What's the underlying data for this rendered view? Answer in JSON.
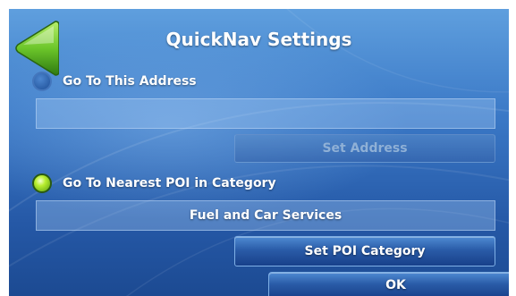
{
  "header": {
    "title": "QuickNav Settings",
    "back_icon": "back-arrow-icon"
  },
  "options": {
    "address": {
      "label": "Go To This Address",
      "selected": false
    },
    "poi": {
      "label": "Go To Nearest POI in Category",
      "selected": true
    }
  },
  "address_field": {
    "value": ""
  },
  "set_address_button": {
    "label": "Set Address",
    "enabled": false
  },
  "poi_field": {
    "value": "Fuel and Car Services"
  },
  "set_poi_button": {
    "label": "Set POI Category"
  },
  "ok_button": {
    "label": "OK"
  },
  "colors": {
    "background_top": "#5f9fde",
    "background_bottom": "#1c4a92",
    "back_arrow": "#6cc62a",
    "radio_selected": "#b8ee30"
  }
}
